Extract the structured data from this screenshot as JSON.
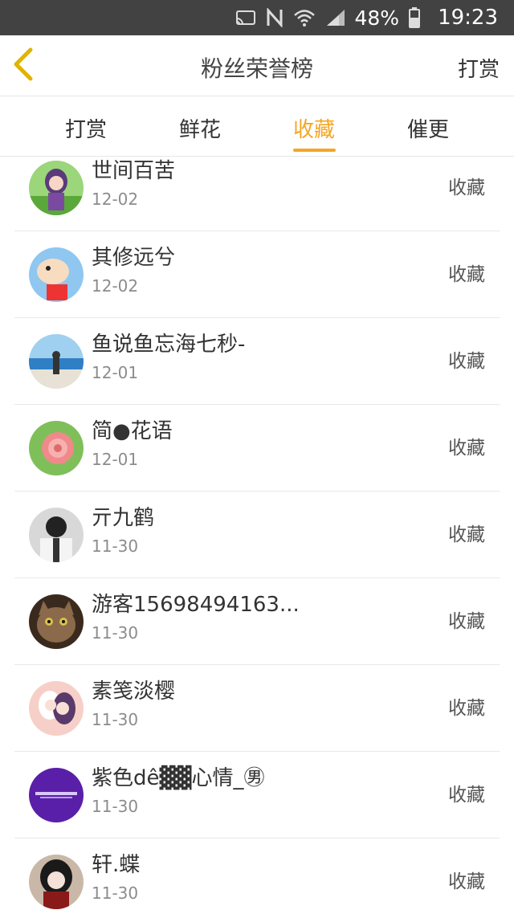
{
  "status_bar": {
    "battery": "48%",
    "time": "19:23"
  },
  "nav": {
    "title": "粉丝荣誉榜",
    "action": "打赏"
  },
  "tabs": [
    {
      "label": "打赏"
    },
    {
      "label": "鲜花"
    },
    {
      "label": "收藏",
      "active": true
    },
    {
      "label": "催更"
    }
  ],
  "colors": {
    "accent": "#f5a623",
    "status_bar": "#424242",
    "back_arrow": "#e6b800"
  },
  "list": [
    {
      "name": "世间百苦",
      "date": "12-02",
      "action": "收藏",
      "avatar": "anime-girl-avatar"
    },
    {
      "name": "其修远兮",
      "date": "12-02",
      "action": "收藏",
      "avatar": "cartoon-avatar"
    },
    {
      "name": "鱼说鱼忘海七秒-",
      "date": "12-01",
      "action": "收藏",
      "avatar": "beach-avatar"
    },
    {
      "name": "简●花语",
      "date": "12-01",
      "action": "收藏",
      "avatar": "flower-avatar"
    },
    {
      "name": "亓九鹤",
      "date": "11-30",
      "action": "收藏",
      "avatar": "person-avatar"
    },
    {
      "name": "游客15698494163...",
      "date": "11-30",
      "action": "收藏",
      "avatar": "cat-avatar"
    },
    {
      "name": "素笺淡樱",
      "date": "11-30",
      "action": "收藏",
      "avatar": "anime-couple-avatar"
    },
    {
      "name": "紫色dê▓▓心情_㊚",
      "date": "11-30",
      "action": "收藏",
      "avatar": "purple-text-avatar"
    },
    {
      "name": "轩.蝶",
      "date": "11-30",
      "action": "收藏",
      "avatar": "anime-portrait-avatar"
    }
  ]
}
